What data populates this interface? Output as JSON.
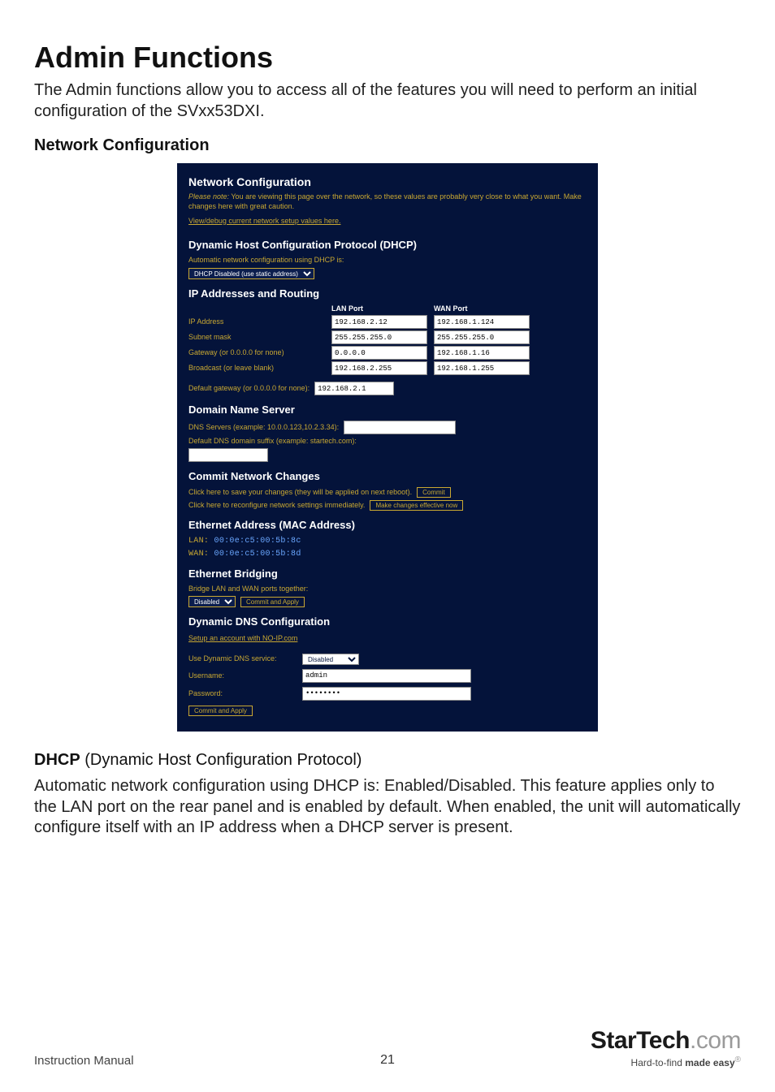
{
  "page": {
    "title": "Admin Functions",
    "intro": "The Admin functions allow you to access all of the features you will need to perform an initial configuration of the SVxx53DXI.",
    "subhead": "Network Configuration"
  },
  "panel": {
    "title": "Network Configuration",
    "note_prefix": "Please note:",
    "note_rest": " You are viewing this page over the network, so these values are probably very close to what you want. Make changes here with great caution.",
    "view_link": "View/debug current network setup values here.",
    "dhcp_heading": "Dynamic Host Configuration Protocol (DHCP)",
    "dhcp_label": "Automatic network configuration using DHCP is:",
    "dhcp_selected": "DHCP Disabled (use static address)",
    "ip_heading": "IP Addresses and Routing",
    "ip_headers": {
      "blank": "",
      "lan": "LAN Port",
      "wan": "WAN Port"
    },
    "ip_rows": [
      {
        "label": "IP Address",
        "lan": "192.168.2.12",
        "wan": "192.168.1.124"
      },
      {
        "label": "Subnet mask",
        "lan": "255.255.255.0",
        "wan": "255.255.255.0"
      },
      {
        "label": "Gateway (or 0.0.0.0 for none)",
        "lan": "0.0.0.0",
        "wan": "192.168.1.16"
      },
      {
        "label": "Broadcast (or leave blank)",
        "lan": "192.168.2.255",
        "wan": "192.168.1.255"
      }
    ],
    "default_gw_label": "Default gateway (or 0.0.0.0 for none):",
    "default_gw_value": "192.168.2.1",
    "dns_heading": "Domain Name Server",
    "dns_servers_label": "DNS Servers (example: 10.0.0.123,10.2.3.34):",
    "dns_servers_value": "",
    "dns_suffix_label": "Default DNS domain suffix (example: startech.com):",
    "dns_suffix_value": "",
    "commit_heading": "Commit Network Changes",
    "commit_save_label": "Click here to save your changes (they will be applied on next reboot).",
    "commit_save_btn": "Commit",
    "commit_apply_label": "Click here to reconfigure network settings immediately.",
    "commit_apply_btn": "Make changes effective now",
    "mac_heading": "Ethernet Address (MAC Address)",
    "mac_lan_key": "LAN:",
    "mac_lan_val": " 00:0e:c5:00:5b:8c",
    "mac_wan_key": "WAN:",
    "mac_wan_val": " 00:0e:c5:00:5b:8d",
    "bridge_heading": "Ethernet Bridging",
    "bridge_label": "Bridge LAN and WAN ports together:",
    "bridge_selected": "Disabled",
    "bridge_btn": "Commit and Apply",
    "ddns_heading": "Dynamic DNS Configuration",
    "ddns_link": "Setup an account with NO-IP.com",
    "ddns_use_label": "Use Dynamic DNS service:",
    "ddns_use_selected": "Disabled",
    "ddns_user_label": "Username:",
    "ddns_user_value": "admin",
    "ddns_pass_label": "Password:",
    "ddns_pass_value": "••••••••",
    "ddns_btn": "Commit and Apply"
  },
  "below": {
    "dhcp_bold": "DHCP",
    "dhcp_rest": " (Dynamic Host Configuration Protocol)",
    "para": "Automatic network configuration using DHCP is: Enabled/Disabled. This feature applies only to the LAN port on the rear panel and is enabled by default.  When enabled, the unit will automatically configure itself with an IP address when a DHCP server is present."
  },
  "footer": {
    "manual": "Instruction Manual",
    "page_no": "21",
    "brand_main": "StarTech",
    "brand_grey": ".com",
    "tag_plain": "Hard-to-find ",
    "tag_bold": "made easy",
    "reg": "®"
  }
}
